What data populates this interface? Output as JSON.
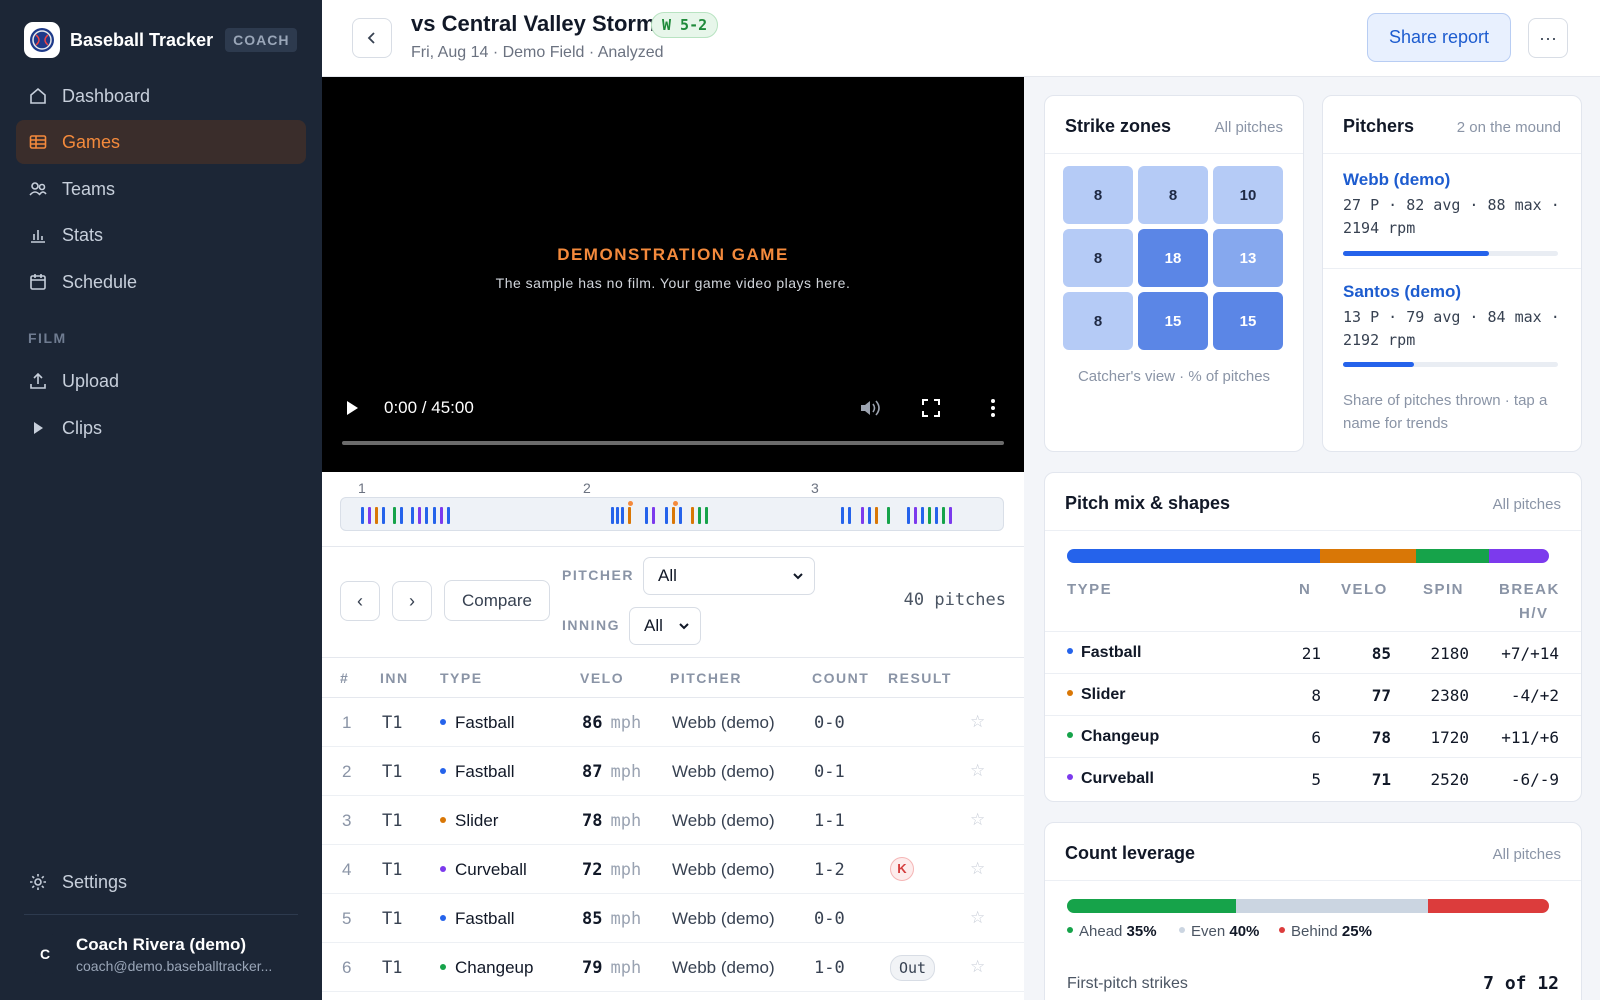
{
  "app": {
    "name": "Baseball Tracker",
    "badge": "COACH"
  },
  "sidebar": {
    "items": [
      {
        "label": "Dashboard",
        "icon": "home-icon"
      },
      {
        "label": "Games",
        "icon": "grid-icon",
        "active": true
      },
      {
        "label": "Teams",
        "icon": "users-icon"
      },
      {
        "label": "Stats",
        "icon": "bar-chart-icon"
      },
      {
        "label": "Schedule",
        "icon": "calendar-icon"
      }
    ],
    "film_section": "FILM",
    "film_items": [
      {
        "label": "Upload",
        "icon": "upload-icon"
      },
      {
        "label": "Clips",
        "icon": "play-icon"
      }
    ],
    "settings": "Settings",
    "user": {
      "initial": "C",
      "name": "Coach Rivera (demo)",
      "email": "coach@demo.baseballtracker..."
    }
  },
  "header": {
    "title": "vs Central Valley Storm",
    "result": "W 5-2",
    "subtitle": "Fri, Aug 14 · Demo Field · Analyzed",
    "share_label": "Share report",
    "more_label": "···"
  },
  "video": {
    "demo_title": "DEMONSTRATION GAME",
    "demo_sub": "The sample has no film. Your game video plays here.",
    "time": "0:00 / 45:00",
    "progress": 0
  },
  "timeline": {
    "innings": [
      "1",
      "2",
      "3"
    ]
  },
  "controls": {
    "prev": "‹",
    "next": "›",
    "compare": "Compare",
    "pitcher_label": "PITCHER",
    "pitcher_value": "All",
    "inning_label": "INNING",
    "inning_value": "All",
    "count_text": "40 pitches"
  },
  "table": {
    "headers": {
      "num": "#",
      "inn": "INN",
      "type": "TYPE",
      "velo": "VELO",
      "pitcher": "PITCHER",
      "count": "COUNT",
      "result": "RESULT"
    },
    "rows": [
      {
        "num": "1",
        "inn": "T1",
        "type": "Fastball",
        "velo": "86",
        "unit": "mph",
        "pitcher": "Webb (demo)",
        "count": "0-0",
        "result": ""
      },
      {
        "num": "2",
        "inn": "T1",
        "type": "Fastball",
        "velo": "87",
        "unit": "mph",
        "pitcher": "Webb (demo)",
        "count": "0-1",
        "result": ""
      },
      {
        "num": "3",
        "inn": "T1",
        "type": "Slider",
        "velo": "78",
        "unit": "mph",
        "pitcher": "Webb (demo)",
        "count": "1-1",
        "result": ""
      },
      {
        "num": "4",
        "inn": "T1",
        "type": "Curveball",
        "velo": "72",
        "unit": "mph",
        "pitcher": "Webb (demo)",
        "count": "1-2",
        "result": "K"
      },
      {
        "num": "5",
        "inn": "T1",
        "type": "Fastball",
        "velo": "85",
        "unit": "mph",
        "pitcher": "Webb (demo)",
        "count": "0-0",
        "result": ""
      },
      {
        "num": "6",
        "inn": "T1",
        "type": "Changeup",
        "velo": "79",
        "unit": "mph",
        "pitcher": "Webb (demo)",
        "count": "1-0",
        "result": "Out"
      }
    ],
    "star": "☆"
  },
  "colors": {
    "fastball": "#2563eb",
    "slider": "#d97706",
    "changeup": "#16a34a",
    "curveball": "#7c3aed",
    "accent": "#f48a3c",
    "ahead": "#16a34a",
    "even": "#cbd5e1",
    "behind": "#dc3c3c"
  },
  "strike_zones": {
    "title": "Strike zones",
    "meta": "All pitches",
    "cells": [
      "8",
      "8",
      "10",
      "8",
      "18",
      "13",
      "8",
      "15",
      "15"
    ],
    "caption": "Catcher's view · % of pitches"
  },
  "pitchers": {
    "title": "Pitchers",
    "meta": "2 on the mound",
    "list": [
      {
        "name": "Webb (demo)",
        "stats": "27 P · 82 avg · 88 max · 2194 rpm",
        "share": 0.68
      },
      {
        "name": "Santos (demo)",
        "stats": "13 P · 79 avg · 84 max · 2192 rpm",
        "share": 0.33
      }
    ],
    "note": "Share of pitches thrown · tap a name for trends"
  },
  "pitch_mix": {
    "title": "Pitch mix & shapes",
    "meta": "All pitches",
    "headers": {
      "type": "TYPE",
      "n": "N",
      "velo": "VELO",
      "spin": "SPIN",
      "break": "BREAK",
      "break2": "H/V"
    },
    "rows": [
      {
        "type": "Fastball",
        "n": "21",
        "velo": "85",
        "spin": "2180",
        "break": "+7/+14"
      },
      {
        "type": "Slider",
        "n": "8",
        "velo": "77",
        "spin": "2380",
        "break": "-4/+2"
      },
      {
        "type": "Changeup",
        "n": "6",
        "velo": "78",
        "spin": "1720",
        "break": "+11/+6"
      },
      {
        "type": "Curveball",
        "n": "5",
        "velo": "71",
        "spin": "2520",
        "break": "-6/-9"
      }
    ]
  },
  "count_leverage": {
    "title": "Count leverage",
    "meta": "All pitches",
    "ahead_label": "Ahead",
    "ahead_pct": "35%",
    "even_label": "Even",
    "even_pct": "40%",
    "behind_label": "Behind",
    "behind_pct": "25%",
    "first_pitch_label": "First-pitch strikes",
    "first_pitch_value": "7 of 12"
  }
}
